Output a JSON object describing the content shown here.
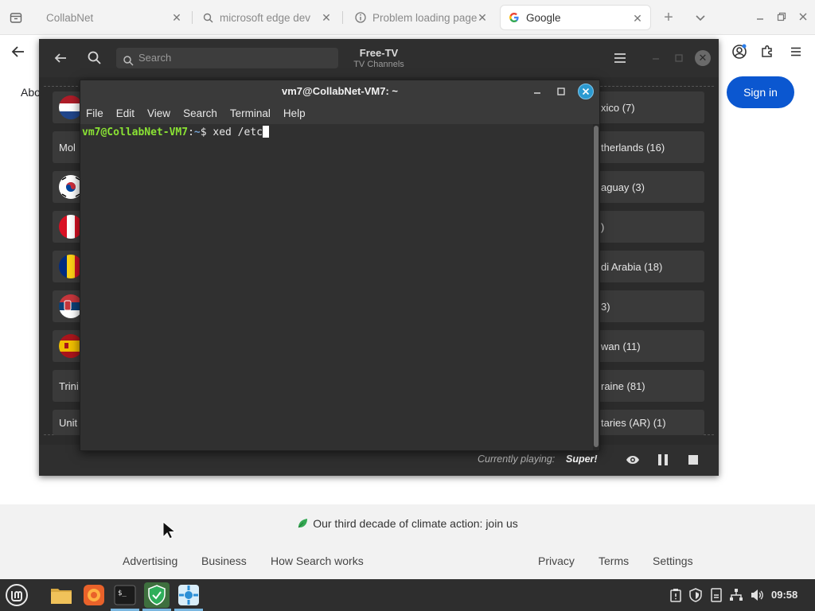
{
  "browser": {
    "tabs": [
      {
        "label": "CollabNet",
        "icon": "generic-page-icon"
      },
      {
        "label": "microsoft edge dev",
        "icon": "search-icon"
      },
      {
        "label": "Problem loading page",
        "icon": "info-icon"
      },
      {
        "label": "Google",
        "icon": "google-g-icon",
        "active": true
      }
    ]
  },
  "google": {
    "about_partial": "Abo",
    "signin_label": "Sign in",
    "climate_text": "Our third decade of climate action: join us",
    "footer_left": [
      "Advertising",
      "Business",
      "How Search works"
    ],
    "footer_right": [
      "Privacy",
      "Terms",
      "Settings"
    ]
  },
  "freetv": {
    "search_placeholder": "Search",
    "title": "Free-TV",
    "subtitle": "TV Channels",
    "left_items": [
      {
        "label": "",
        "flag": "netherlands"
      },
      {
        "label": "Mol",
        "flag": ""
      },
      {
        "label": "",
        "flag": "south-korea"
      },
      {
        "label": "",
        "flag": "peru"
      },
      {
        "label": "",
        "flag": "romania"
      },
      {
        "label": "",
        "flag": "serbia"
      },
      {
        "label": "",
        "flag": "spain"
      },
      {
        "label": "Trini",
        "flag": ""
      },
      {
        "label": "Unit",
        "flag": ""
      }
    ],
    "right_items": [
      "xico (7)",
      "therlands (16)",
      "aguay (3)",
      ")",
      "di Arabia (18)",
      "3)",
      "wan (11)",
      "raine (81)",
      "taries (AR) (1)"
    ],
    "currently_playing_label": "Currently playing:",
    "currently_playing_value": "Super!"
  },
  "terminal": {
    "title": "vm7@CollabNet-VM7: ~",
    "menu": [
      "File",
      "Edit",
      "View",
      "Search",
      "Terminal",
      "Help"
    ],
    "prompt_user": "vm7@CollabNet-VM7",
    "prompt_sep": ":",
    "prompt_path": "~",
    "prompt_end": "$ ",
    "command": "xed /etc"
  },
  "taskbar": {
    "clock": "09:58",
    "apps": [
      "files-icon",
      "firefox-icon",
      "terminal-icon",
      "warpinator-shield-icon",
      "mintinstall-icon"
    ]
  },
  "colors": {
    "accent_blue": "#0b57d0",
    "terminal_prompt_green": "#8ae234",
    "terminal_close": "#2b9ad1"
  }
}
